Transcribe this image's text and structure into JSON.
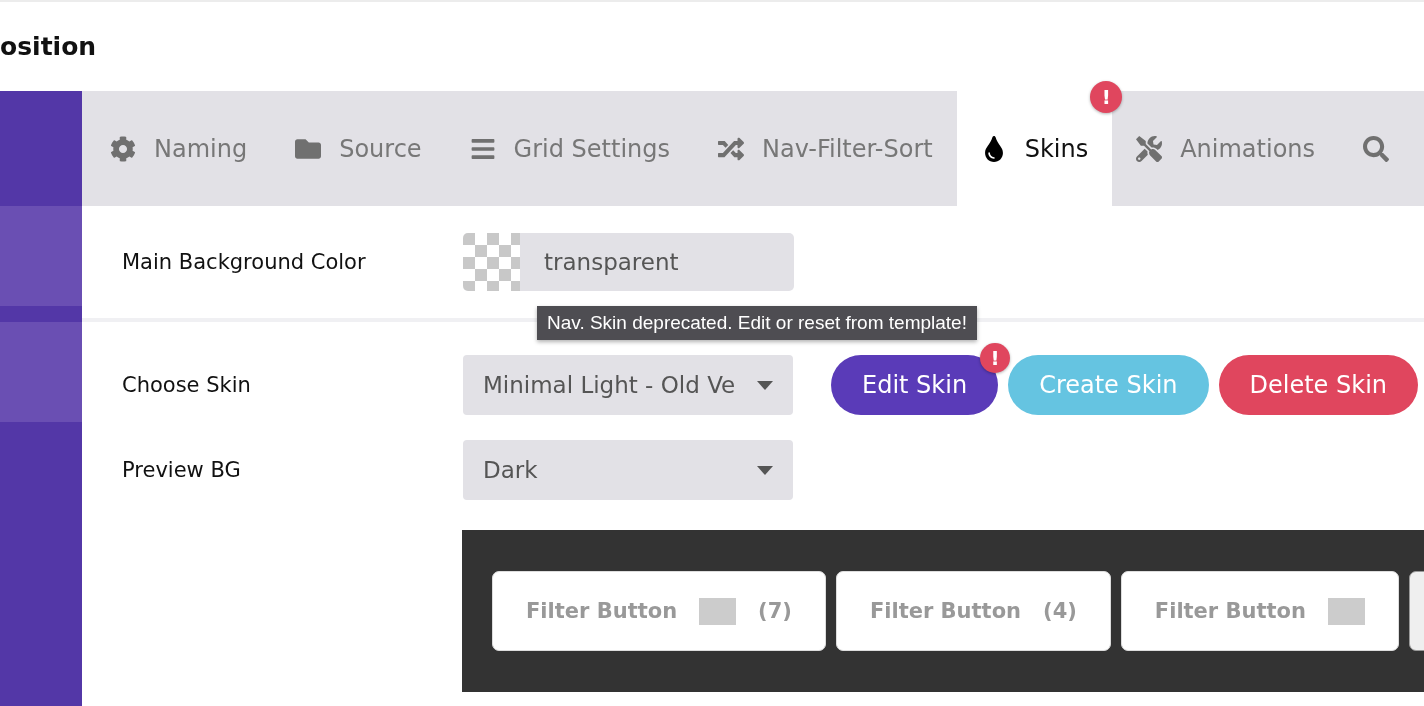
{
  "page_title": "osition",
  "tabs": [
    {
      "label": "Naming",
      "selected": false,
      "alert": false
    },
    {
      "label": "Source",
      "selected": false,
      "alert": false
    },
    {
      "label": "Grid Settings",
      "selected": false,
      "alert": false
    },
    {
      "label": "Nav-Filter-Sort",
      "selected": false,
      "alert": false
    },
    {
      "label": "Skins",
      "selected": true,
      "alert": true
    },
    {
      "label": "Animations",
      "selected": false,
      "alert": false
    },
    {
      "selected": false,
      "alert": false
    }
  ],
  "alert_mark": "!",
  "main_background": {
    "label": "Main Background Color",
    "value": "transparent"
  },
  "tooltip": "Nav. Skin deprecated. Edit or reset from template!",
  "choose_skin": {
    "label": "Choose Skin",
    "value": "Minimal Light - Old Ve"
  },
  "skin_buttons": [
    {
      "label": "Edit Skin",
      "kind": "edit",
      "alert": true
    },
    {
      "label": "Create Skin",
      "kind": "create",
      "alert": false
    },
    {
      "label": "Delete Skin",
      "kind": "delete",
      "alert": false
    }
  ],
  "preview_bg": {
    "label": "Preview BG",
    "value": "Dark"
  },
  "preview_buttons": [
    {
      "label": "Filter Button",
      "swatch": true,
      "count": "(7)"
    },
    {
      "label": "Filter Button",
      "swatch": false,
      "count": "(4)"
    },
    {
      "label": "Filter Button",
      "swatch": true
    },
    {
      "kind": "cut",
      "swatch": false
    }
  ]
}
